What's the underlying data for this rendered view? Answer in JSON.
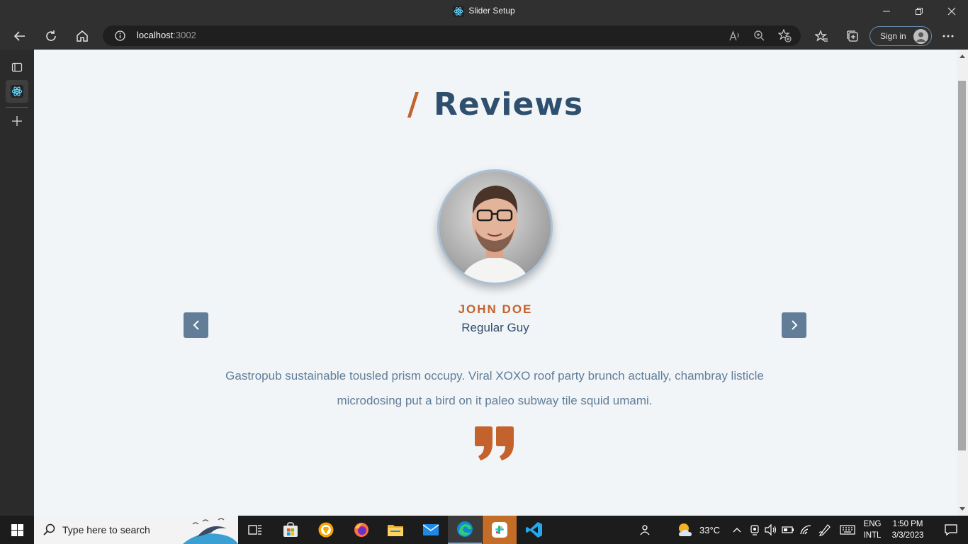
{
  "window": {
    "title": "Slider Setup"
  },
  "browser": {
    "url_host": "localhost",
    "url_port": ":3002",
    "signin_label": "Sign in"
  },
  "page": {
    "heading_slash": "/",
    "heading": "Reviews",
    "review": {
      "name": "JOHN DOE",
      "job": "Regular Guy",
      "text": "Gastropub sustainable tousled prism occupy. Viral XOXO roof party brunch actually, chambray listicle microdosing put a bird on it paleo subway tile squid umami."
    }
  },
  "taskbar": {
    "search_placeholder": "Type here to search",
    "weather": "33°C",
    "lang_top": "ENG",
    "lang_bottom": "INTL",
    "time": "1:50 PM",
    "date": "3/3/2023"
  },
  "colors": {
    "accent": "#c4622d",
    "heading": "#2f4f6e",
    "button": "#617d98",
    "page_bg": "#f1f5f8"
  }
}
